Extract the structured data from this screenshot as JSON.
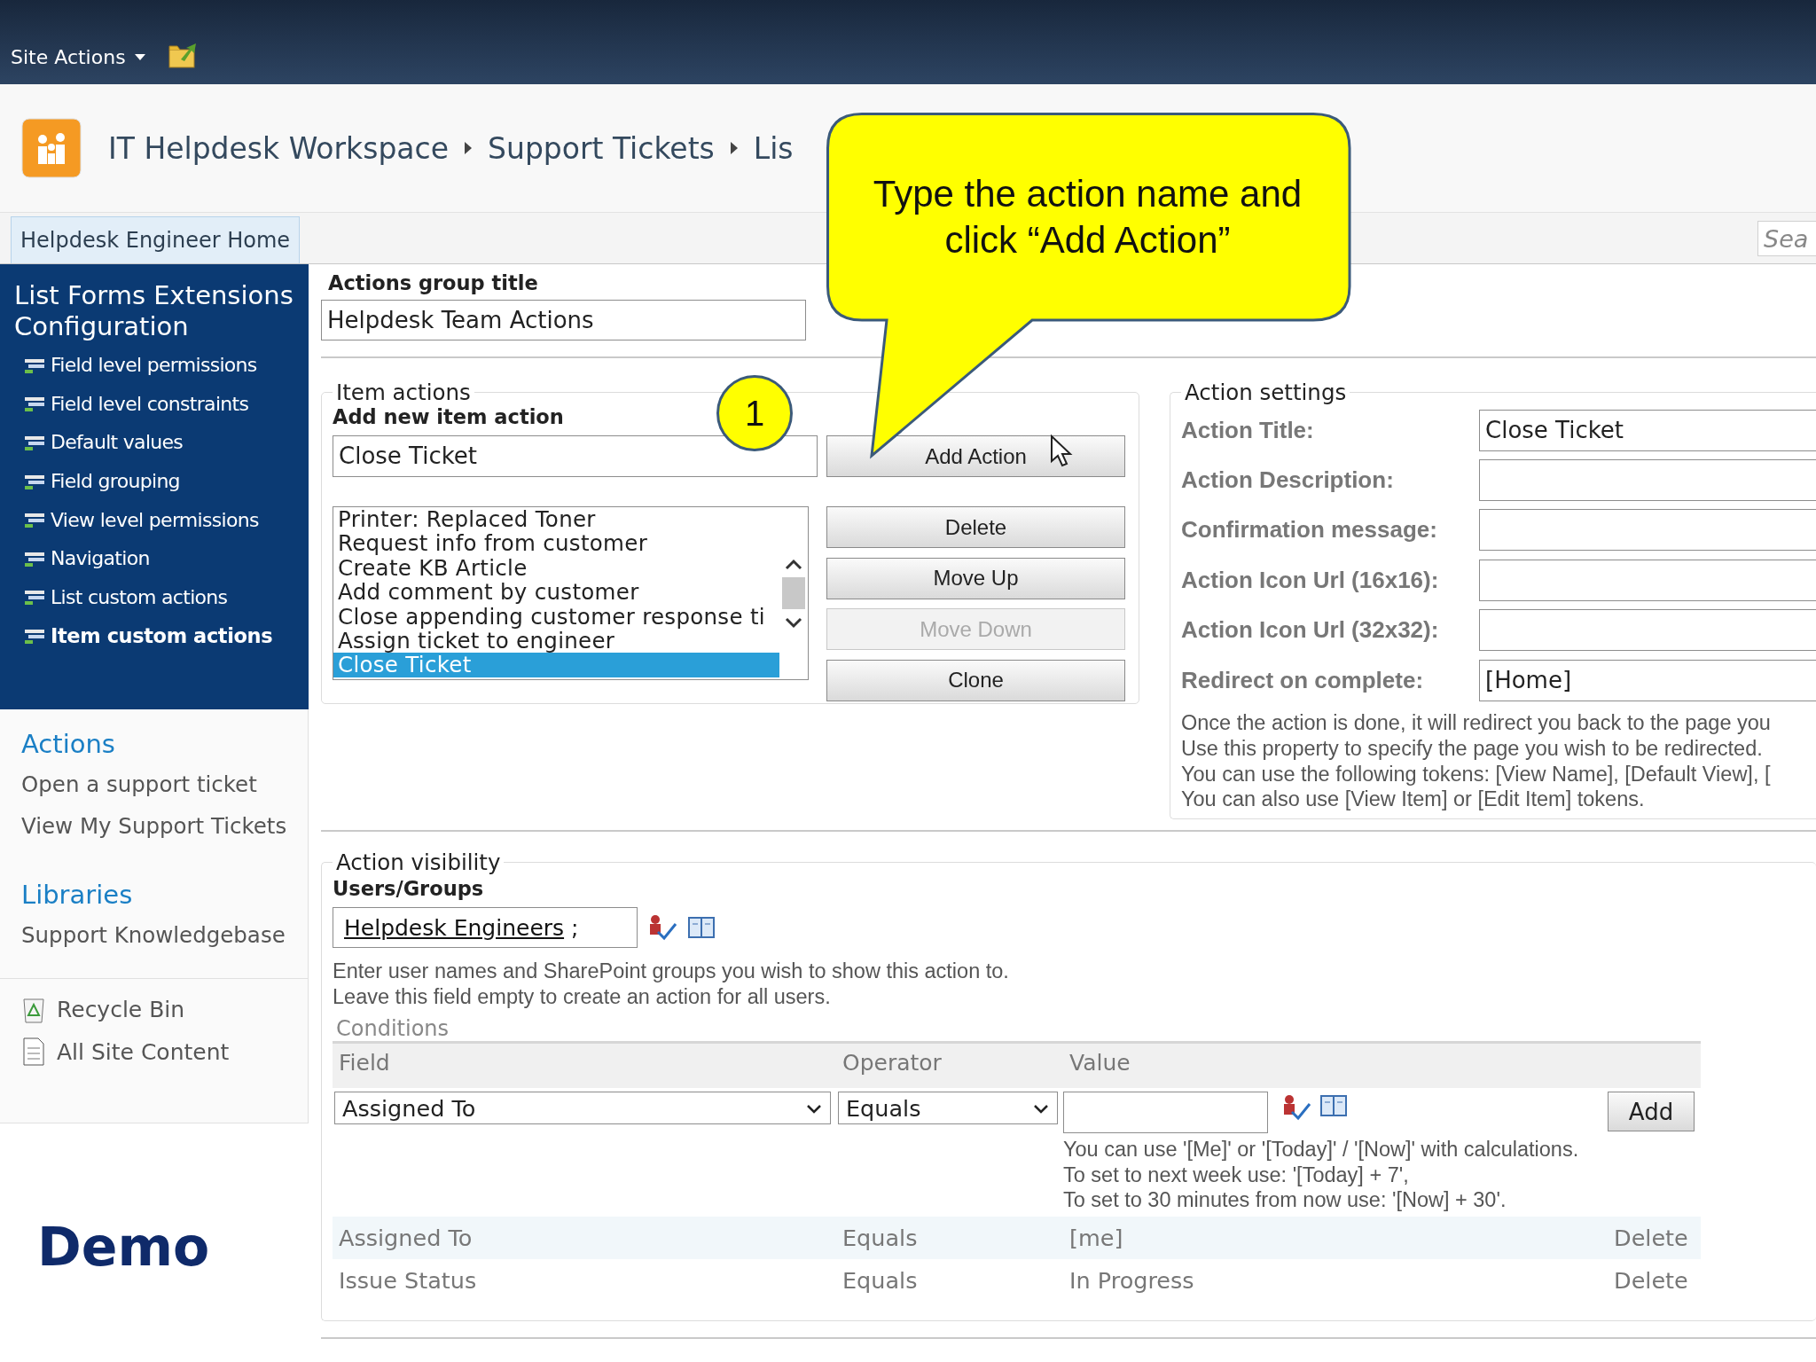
{
  "top_bar": {
    "site_actions": "Site Actions"
  },
  "breadcrumb": [
    "IT Helpdesk Workspace",
    "Support Tickets",
    "Lis"
  ],
  "nav": {
    "home_tab": "Helpdesk Engineer Home",
    "search_placeholder": "Sea"
  },
  "sidebar": {
    "title": "List Forms Extensions Configuration",
    "items": [
      {
        "label": "Field level permissions",
        "selected": false
      },
      {
        "label": "Field level constraints",
        "selected": false
      },
      {
        "label": "Default values",
        "selected": false
      },
      {
        "label": "Field grouping",
        "selected": false
      },
      {
        "label": "View level permissions",
        "selected": false
      },
      {
        "label": "Navigation",
        "selected": false
      },
      {
        "label": "List custom actions",
        "selected": false
      },
      {
        "label": "Item custom actions",
        "selected": true
      }
    ],
    "sections": [
      {
        "heading": "Actions",
        "links": [
          "Open a support ticket",
          "View My Support Tickets"
        ]
      },
      {
        "heading": "Libraries",
        "links": [
          "Support Knowledgebase"
        ]
      }
    ],
    "footer_links": [
      "Recycle Bin",
      "All Site Content"
    ]
  },
  "slide_label": "Demo",
  "group_title": {
    "label": "Actions group title",
    "value": "Helpdesk Team Actions"
  },
  "item_actions": {
    "legend": "Item actions",
    "label": "Add new item action",
    "value": "Close Ticket",
    "list": [
      {
        "text": "Printer: Replaced Toner",
        "selected": false
      },
      {
        "text": "Request info from customer",
        "selected": false
      },
      {
        "text": "Create KB Article",
        "selected": false
      },
      {
        "text": "Add comment by customer",
        "selected": false
      },
      {
        "text": "Close appending customer response ti",
        "selected": false
      },
      {
        "text": "Assign ticket to engineer",
        "selected": false
      },
      {
        "text": "Close Ticket",
        "selected": true
      }
    ],
    "buttons": [
      {
        "label": "Add Action",
        "disabled": false
      },
      {
        "label": "Delete",
        "disabled": false
      },
      {
        "label": "Move Up",
        "disabled": false
      },
      {
        "label": "Move Down",
        "disabled": true
      },
      {
        "label": "Clone",
        "disabled": false
      }
    ]
  },
  "action_settings": {
    "legend": "Action settings",
    "fields": [
      {
        "label": "Action Title:",
        "value": "Close Ticket"
      },
      {
        "label": "Action Description:"
      },
      {
        "label": "Confirmation message:"
      },
      {
        "label": "Action Icon Url (16x16):"
      },
      {
        "label": "Action Icon Url (32x32):"
      },
      {
        "label": "Redirect on complete:",
        "value": "[Home]"
      }
    ],
    "help": "Once the action is done, it will redirect you back to the page you\nUse this property to specify the page you wish to be redirected.\nYou can use the following tokens: [View Name], [Default View], [\nYou can also use [View Item] or [Edit Item] tokens."
  },
  "action_visibility": {
    "legend": "Action visibility",
    "users_label": "Users/Groups",
    "users_value": "Helpdesk Engineers",
    "users_suffix": ";",
    "help": "Enter user names and SharePoint groups you wish to show this action to.\nLeave this field empty to create an action for all users.",
    "conditions": {
      "title": "Conditions",
      "columns": [
        "Field",
        "Operator",
        "Value"
      ],
      "field_select": "Assigned To",
      "operator_select": "Equals",
      "add_button": "Add",
      "value_help": "You can use '[Me]' or '[Today]' / '[Now]' with calculations.\nTo set to next week use: '[Today] + 7',\nTo set to 30 minutes from now use: '[Now] + 30'.",
      "rows": [
        {
          "field": "Assigned To",
          "operator": "Equals",
          "value": "[me]",
          "action": "Delete"
        },
        {
          "field": "Issue Status",
          "operator": "Equals",
          "value": "In Progress",
          "action": "Delete"
        }
      ]
    }
  },
  "callout": {
    "text": "Type the action name and\nclick “Add Action”",
    "step": "1"
  }
}
